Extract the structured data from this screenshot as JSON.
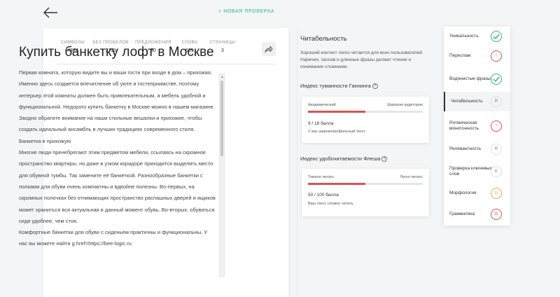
{
  "header": {
    "new_check": "+ НОВАЯ ПРОВЕРКА"
  },
  "stats": [
    {
      "label": "СИМВОЛЫ",
      "value": "4324"
    },
    {
      "label": "БЕЗ ПРОБЕЛОВ",
      "value": "3759"
    },
    {
      "label": "ПРЕДЛОЖЕНИЯ",
      "value": "30"
    },
    {
      "label": "СЛОВА",
      "value": "585"
    },
    {
      "label": "СТРАНИЦЫ",
      "value": "3"
    }
  ],
  "document": {
    "title": "Купить банкетку лофт в Москве",
    "paragraphs": [
      "Первая комната, которую видите вы и ваши гости при входе в дом – прихожая. Именно здесь создается впечатление об уюте и гостеприимстве, поэтому интерьер этой комнаты должен быть привлекательным, а мебель удобной и функциональной. Недорого купить банкетку в Москве можно в нашем магазине. Заодно обратите внимание на наши стильные вешалки и прихожие, чтобы создать идеальный ансамбль в лучших традициях современного стиля.",
      "Банкетка в прихожую",
      "Многие люди пренебрегают этим предметом мебели, ссылаясь на скромное пространство квартиры, но даже в узком коридоре приходится выделять место для обувной тумбы. Так замените её банкеткой. Разнообразные банкетки с полками для обуви очень компактны и вдвойне полезны. Во-первых, на скромных полочках без отнимающих пространство распашных дверей и ящиков может храниться вся актуальная в данный момент обувь. Во-вторых, обуваться сидя удобнее, чем стоя.",
      "Комфортные банкетки для обуви с сиденьем практичны и функциональны. У нас вы можете найти g href=https://bee-logic.ru"
    ]
  },
  "panel": {
    "title": "Читабельность",
    "description": "Хороший контент легко читается для всех пользователей. Наречия, пассив и длинные фразы делают чтение и понимание сложными.",
    "gunning": {
      "title": "Индекс туманности Ганнинга",
      "left": "Академический",
      "right": "Широкая аудитория",
      "fill": 0.5,
      "score": "9 / 18 балла",
      "note": "У вас широкопрофильный текст"
    },
    "flesch": {
      "title": "Индекс удобочитаемости Флеша",
      "left": "Тяжело читать",
      "right": "Легко читать",
      "fill": 0.5,
      "score": "50 / 100 балла",
      "note": "Ваш текст сложно читать"
    }
  },
  "checks": [
    {
      "name": "Уникальность",
      "status": "ok",
      "badge": ""
    },
    {
      "name": "Переспам",
      "status": "red",
      "badge": "!"
    },
    {
      "name": "Водянистые фразы",
      "status": "ok",
      "badge": ""
    },
    {
      "name": "Читабельность",
      "status": "grey",
      "badge": "R",
      "active": true
    },
    {
      "name": "Ритмическая монотонность",
      "status": "red",
      "badge": "!"
    },
    {
      "name": "Релевантность",
      "status": "grey",
      "badge": "R"
    },
    {
      "name": "Проверка ключевых слов",
      "status": "grey",
      "badge": "K"
    },
    {
      "name": "Морфология",
      "status": "orange",
      "badge": "G"
    },
    {
      "name": "Грамматика",
      "status": "red",
      "badge": "B"
    }
  ],
  "colors": {
    "accent": "#29b887",
    "danger": "#d9534f",
    "warning": "#eba93a"
  }
}
